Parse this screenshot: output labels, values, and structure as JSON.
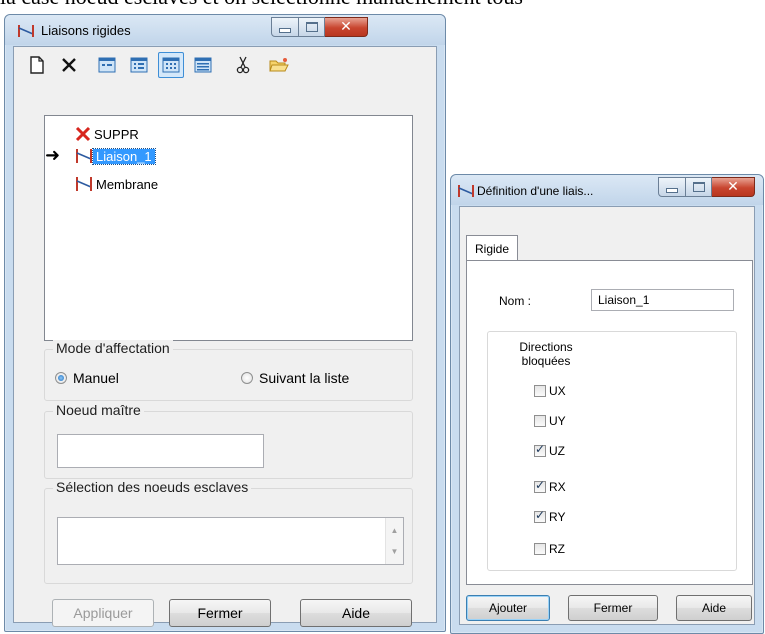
{
  "document": {
    "text": "la case noeud esclaves et on sélectionne manuellement tous"
  },
  "window1": {
    "title": "Liaisons rigides",
    "toolbar": {
      "icons": [
        "new-icon",
        "delete-icon",
        "view-small-icon",
        "view-list-icon",
        "view-grid-icon",
        "view-details-icon",
        "cut-icon",
        "open-folder-icon"
      ],
      "active_index": 4
    },
    "tree": [
      {
        "label": "SUPPR",
        "icon": "red-x-icon",
        "selected": false
      },
      {
        "label": "Liaison_1",
        "icon": "rigid-link-icon",
        "selected": true
      },
      {
        "label": "Membrane",
        "icon": "rigid-link-icon",
        "selected": false
      }
    ],
    "mode": {
      "title": "Mode d'affectation",
      "option_manual": "Manuel",
      "option_list": "Suivant la liste",
      "selected": "Manuel"
    },
    "master_node": {
      "title": "Noeud maître",
      "value": ""
    },
    "slave_nodes": {
      "title": "Sélection des noeuds esclaves",
      "value": ""
    },
    "buttons": {
      "apply": "Appliquer",
      "close": "Fermer",
      "help": "Aide"
    }
  },
  "window2": {
    "title": "Définition d'une liais...",
    "tab": "Rigide",
    "name_label": "Nom :",
    "name_value": "Liaison_1",
    "directions_title_1": "Directions",
    "directions_title_2": "bloquées",
    "directions": [
      {
        "label": "UX",
        "checked": false
      },
      {
        "label": "UY",
        "checked": false
      },
      {
        "label": "UZ",
        "checked": true
      },
      {
        "label": "RX",
        "checked": true
      },
      {
        "label": "RY",
        "checked": true
      },
      {
        "label": "RZ",
        "checked": false
      }
    ],
    "buttons": {
      "add": "Ajouter",
      "close": "Fermer",
      "help": "Aide"
    }
  },
  "colors": {
    "selection": "#3399ff",
    "title_bar": "#c9dcef",
    "close_button": "#c8452f",
    "delete_red": "#d7261e"
  }
}
